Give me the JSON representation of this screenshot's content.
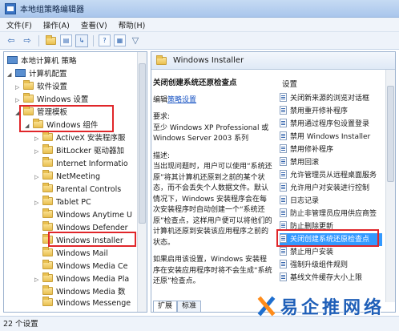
{
  "window": {
    "title": "本地组策略编辑器"
  },
  "menu": [
    "文件(F)",
    "操作(A)",
    "查看(V)",
    "帮助(H)"
  ],
  "toolbar_icons": [
    "back-arrow-icon",
    "forward-arrow-icon",
    "folder-up-icon",
    "show-tree-icon",
    "export-icon",
    "help-icon",
    "properties-icon",
    "filter-icon"
  ],
  "tree": {
    "items": [
      {
        "label": "本地计算机 策略",
        "icon": "computer-icon",
        "level": 0
      },
      {
        "label": "计算机配置",
        "icon": "computer-icon",
        "level": 1
      },
      {
        "label": "软件设置",
        "icon": "folder-icon",
        "level": 2
      },
      {
        "label": "Windows 设置",
        "icon": "folder-icon",
        "level": 2
      },
      {
        "label": "管理模板",
        "icon": "folder-icon",
        "level": 2
      },
      {
        "label": "Windows 组件",
        "icon": "folder-icon",
        "level": 3
      },
      {
        "label": "ActiveX 安装程序服",
        "icon": "folder-icon",
        "level": 4
      },
      {
        "label": "BitLocker 驱动器加",
        "icon": "folder-icon",
        "level": 4
      },
      {
        "label": "Internet Informatio",
        "icon": "folder-icon",
        "level": 4
      },
      {
        "label": "NetMeeting",
        "icon": "folder-icon",
        "level": 4
      },
      {
        "label": "Parental Controls",
        "icon": "folder-icon",
        "level": 4
      },
      {
        "label": "Tablet PC",
        "icon": "folder-icon",
        "level": 4
      },
      {
        "label": "Windows Anytime U",
        "icon": "folder-icon",
        "level": 4
      },
      {
        "label": "Windows Defender",
        "icon": "folder-icon",
        "level": 4
      },
      {
        "label": "Windows Installer",
        "icon": "folder-icon",
        "level": 4
      },
      {
        "label": "Windows Mail",
        "icon": "folder-icon",
        "level": 4
      },
      {
        "label": "Windows Media Ce",
        "icon": "folder-icon",
        "level": 4
      },
      {
        "label": "Windows Media Pla",
        "icon": "folder-icon",
        "level": 4
      },
      {
        "label": "Windows Media 数",
        "icon": "folder-icon",
        "level": 4
      },
      {
        "label": "Windows Messenge",
        "icon": "folder-icon",
        "level": 4
      }
    ]
  },
  "right": {
    "header": "Windows Installer",
    "policy_title": "关闭创建系统还原检查点",
    "edit_prefix": "编辑",
    "edit_link": "策略设置",
    "requirements_label": "要求:",
    "requirements": "至少 Windows XP Professional 或 Windows Server 2003 系列",
    "description_label": "描述:",
    "description": "当出现问题时，用户可以使用“系统还原”将其计算机还原到之前的某个状态，而不会丢失个人数据文件。默认情况下，Windows 安装程序会在每次安装程序时自动创建一个“系统还原”检查点，这样用户便可以将他们的计算机还原到安装该应用程序之前的状态。",
    "description2": "如果启用该设置，Windows 安装程序在安装应用程序时将不会生成“系统还原”检查点。",
    "column_header": "设置",
    "settings": [
      "关闭新来源的浏览对话框",
      "禁用重开修补程序",
      "禁用通过程序包设置登录",
      "禁用 Windows Installer",
      "禁用修补程序",
      "禁用回滚",
      "允许管理员从远程桌面服务",
      "允许用户对安装进行控制",
      "日志记录",
      "防止非管理员应用供应商签",
      "防止删除更新",
      "关闭创建系统还原检查点",
      "禁止用户安装",
      "强制升级组件规则",
      "基线文件缓存大小上限"
    ],
    "tabs": [
      "扩展",
      "标准"
    ]
  },
  "status": {
    "text": "22 个设置"
  },
  "watermark": {
    "text": "易企推网络"
  }
}
